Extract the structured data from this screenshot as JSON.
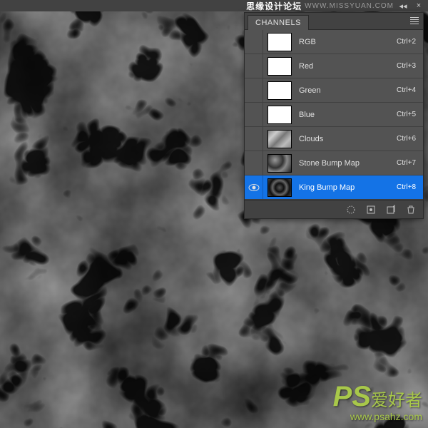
{
  "watermark": {
    "title": "思缘设计论坛",
    "url": "WWW.MISSYUAN.COM"
  },
  "panel": {
    "tab": "CHANNELS"
  },
  "channels": [
    {
      "name": "RGB",
      "shortcut": "Ctrl+2",
      "thumb": "white",
      "visible": false,
      "selected": false
    },
    {
      "name": "Red",
      "shortcut": "Ctrl+3",
      "thumb": "white",
      "visible": false,
      "selected": false
    },
    {
      "name": "Green",
      "shortcut": "Ctrl+4",
      "thumb": "white",
      "visible": false,
      "selected": false
    },
    {
      "name": "Blue",
      "shortcut": "Ctrl+5",
      "thumb": "white",
      "visible": false,
      "selected": false
    },
    {
      "name": "Clouds",
      "shortcut": "Ctrl+6",
      "thumb": "clouds",
      "visible": false,
      "selected": false
    },
    {
      "name": "Stone Bump Map",
      "shortcut": "Ctrl+7",
      "thumb": "stone",
      "visible": false,
      "selected": false
    },
    {
      "name": "King Bump Map",
      "shortcut": "Ctrl+8",
      "thumb": "king",
      "visible": true,
      "selected": true
    }
  ],
  "logo": {
    "brand": "PS",
    "tagline": "爱好者",
    "url": "www.psahz.com"
  }
}
